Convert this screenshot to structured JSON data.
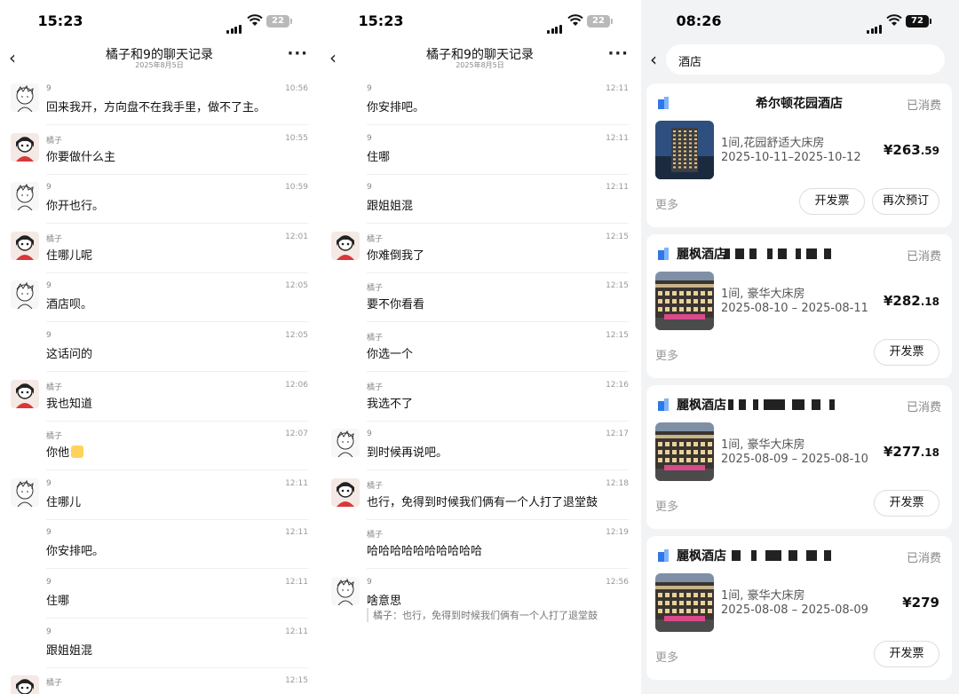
{
  "chat_left": {
    "status": {
      "time": "15:23",
      "battery": "22"
    },
    "nav": {
      "title": "橘子和9的聊天记录",
      "date": "2025年8月5日"
    },
    "messages": [
      {
        "name": "9",
        "time": "10:56",
        "text": "回来我开，方向盘不在我手里，做不了主。",
        "avatar": "a9"
      },
      {
        "name": "橘子",
        "time": "10:55",
        "text": "你要做什么主",
        "avatar": "aj"
      },
      {
        "name": "9",
        "time": "10:59",
        "text": "你开也行。",
        "avatar": "a9"
      },
      {
        "name": "橘子",
        "time": "12:01",
        "text": "住哪儿呢",
        "avatar": "aj"
      },
      {
        "name": "9",
        "time": "12:05",
        "text": "酒店呗。",
        "avatar": "a9"
      },
      {
        "name": "9",
        "time": "12:05",
        "text": "这话问的",
        "avatar": ""
      },
      {
        "name": "橘子",
        "time": "12:06",
        "text": "我也知道",
        "avatar": "aj"
      },
      {
        "name": "橘子",
        "time": "12:07",
        "text": "你他",
        "avatar": "",
        "emoji": true
      },
      {
        "name": "9",
        "time": "12:11",
        "text": "住哪儿",
        "avatar": "a9"
      },
      {
        "name": "9",
        "time": "12:11",
        "text": "你安排吧。",
        "avatar": ""
      },
      {
        "name": "9",
        "time": "12:11",
        "text": "住哪",
        "avatar": ""
      },
      {
        "name": "9",
        "time": "12:11",
        "text": "跟姐姐混",
        "avatar": ""
      },
      {
        "name": "橘子",
        "time": "12:15",
        "text": "",
        "avatar": "aj"
      }
    ]
  },
  "chat_right": {
    "status": {
      "time": "15:23",
      "battery": "22"
    },
    "nav": {
      "title": "橘子和9的聊天记录",
      "date": "2025年8月5日"
    },
    "messages": [
      {
        "name": "9",
        "time": "12:11",
        "text": "你安排吧。",
        "avatar": ""
      },
      {
        "name": "9",
        "time": "12:11",
        "text": "住哪",
        "avatar": ""
      },
      {
        "name": "9",
        "time": "12:11",
        "text": "跟姐姐混",
        "avatar": ""
      },
      {
        "name": "橘子",
        "time": "12:15",
        "text": "你难倒我了",
        "avatar": "aj"
      },
      {
        "name": "橘子",
        "time": "12:15",
        "text": "要不你看看",
        "avatar": ""
      },
      {
        "name": "橘子",
        "time": "12:15",
        "text": "你选一个",
        "avatar": ""
      },
      {
        "name": "橘子",
        "time": "12:16",
        "text": "我选不了",
        "avatar": ""
      },
      {
        "name": "9",
        "time": "12:17",
        "text": "到时候再说吧。",
        "avatar": "a9"
      },
      {
        "name": "橘子",
        "time": "12:18",
        "text": "也行，免得到时候我们俩有一个人打了退堂鼓",
        "avatar": "aj"
      },
      {
        "name": "橘子",
        "time": "12:19",
        "text": "哈哈哈哈哈哈哈哈哈哈",
        "avatar": ""
      },
      {
        "name": "9",
        "time": "12:56",
        "text": "啥意思",
        "avatar": "a9",
        "quote": "橘子：也行，免得到时候我们俩有一个人打了退堂鼓"
      }
    ]
  },
  "hotels": {
    "status": {
      "time": "08:26",
      "battery": "72"
    },
    "search": {
      "query": "酒店"
    },
    "orders": [
      {
        "name": "希尔顿花园酒店",
        "status": "已消费",
        "room": "1间,花园舒适大床房",
        "dates": "2025-10-11–2025-10-12",
        "price_int": "¥263",
        "price_dec": ".59",
        "more": "更多",
        "buttons": [
          "开发票",
          "再次预订"
        ],
        "logo": "hilton-icon"
      },
      {
        "name": "麗枫酒店",
        "status": "已消费",
        "room": "1间, 豪华大床房",
        "dates": "2025-08-10 – 2025-08-11",
        "price_int": "¥282",
        "price_dec": ".18",
        "more": "更多",
        "buttons": [
          "开发票"
        ],
        "logo": "lavande-icon"
      },
      {
        "name": "麗枫酒店",
        "status": "已消费",
        "room": "1间, 豪华大床房",
        "dates": "2025-08-09 – 2025-08-10",
        "price_int": "¥277",
        "price_dec": ".18",
        "more": "更多",
        "buttons": [
          "开发票"
        ],
        "logo": "lavande-icon"
      },
      {
        "name": "麗枫酒店",
        "status": "已消费",
        "room": "1间, 豪华大床房",
        "dates": "2025-08-08 – 2025-08-09",
        "price_int": "¥279",
        "price_dec": "",
        "more": "更多",
        "buttons": [
          "开发票"
        ],
        "logo": "lavande-icon"
      }
    ]
  }
}
